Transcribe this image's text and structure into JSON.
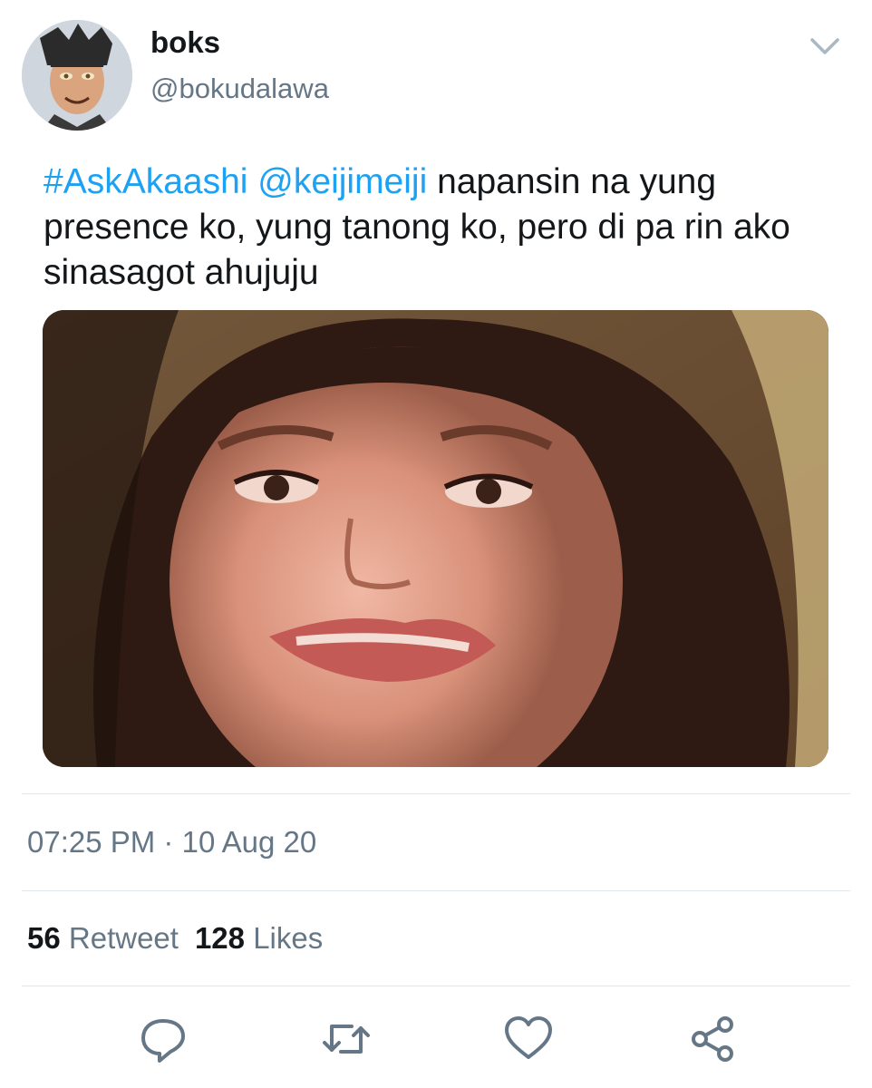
{
  "user": {
    "display_name": "boks",
    "handle": "@bokudalawa",
    "avatar_icon": "anime-character-avatar"
  },
  "tweet": {
    "hashtag": "#AskAkaashi",
    "mention": "@keijimeiji",
    "text": "napansin na yung presence ko, yung tanong ko, pero di pa rin ako sinasagot ahujuju",
    "media_icon": "crying-woman-photo",
    "time": "07:25 PM",
    "separator": "·",
    "date": "10 Aug 20"
  },
  "stats": {
    "retweets_count": "56",
    "retweets_label": "Retweet",
    "likes_count": "128",
    "likes_label": "Likes"
  },
  "actions": {
    "reply_icon": "reply-icon",
    "retweet_icon": "retweet-icon",
    "like_icon": "heart-icon",
    "share_icon": "share-icon"
  },
  "colors": {
    "link": "#1da1f2",
    "secondary_text": "#657786",
    "primary_text": "#14171a",
    "divider": "#e1e8ed"
  }
}
